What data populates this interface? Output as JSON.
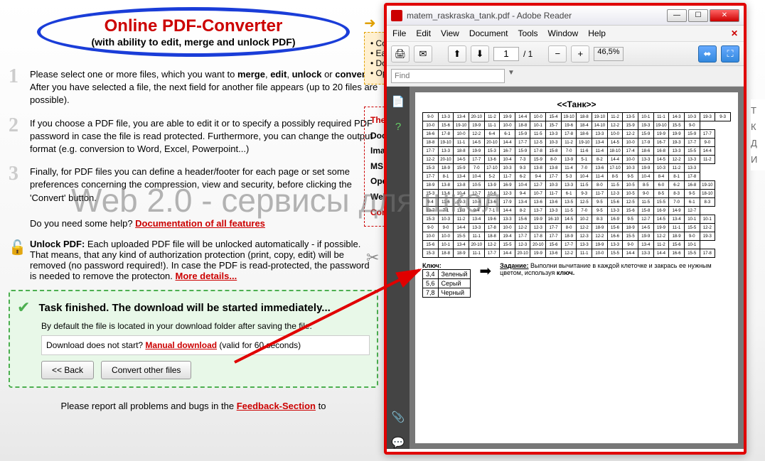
{
  "header": {
    "title": "Online PDF-Converter",
    "subtitle": "(with ability to edit, merge and unlock PDF)"
  },
  "steps": {
    "s1a": "Please select one or more files, which you want to ",
    "s1b": "merge",
    "s1c": ", ",
    "s1d": "edit",
    "s1e": ", ",
    "s1f": "unlock",
    "s1g": " or ",
    "s1h": "convert",
    "s1i": ". After you have selected a file, the next field for another file appears (up to 20 files are possible).",
    "s2": "If you choose a PDF file, you are able to edit it or to specify a possibly required PDF password in case the file is read protected. Furthermore, you can change the output format (e.g. conversion to Word, Excel, Powerpoint...)",
    "s3": "Finally, for PDF files you can define a header/footer for each page or set some preferences concerning the compression, view and security, before clicking the 'Convert' button.",
    "help_prefix": "Do you need some help? ",
    "help_link": "Documentation of all features"
  },
  "unlock": {
    "title": "Unlock PDF:",
    "text": " Each uploaded PDF file will be unlocked automatically - if possible. That means, that any kind of authorization protection (print, copy, edit) will be removed (no password required!). In case the PDF is read-protected, the password is needed to remove the protecton. ",
    "link": "More details..."
  },
  "task": {
    "title": "Task finished. The download will be started immediately...",
    "subtitle": "By default the file is located in your download folder after saving the file.",
    "dl_prefix": "Download does not start? ",
    "dl_link": "Manual download",
    "dl_suffix": " (valid for 60 seconds)",
    "back": "<< Back",
    "convert": "Convert other files"
  },
  "report": {
    "prefix": "Please report all problems and bugs in the ",
    "link": "Feedback-Section",
    "suffix": " to"
  },
  "orange": {
    "l1": "Co",
    "l2": "Ea",
    "l3": "Do",
    "l4": "Op"
  },
  "sidebar": {
    "the": "The",
    "doc": "Docu",
    "img": "Imag",
    "ms": "MS C",
    "ope": "Ope",
    "web": "Web",
    "con": "Con"
  },
  "reader": {
    "title": "matem_raskraska_tank.pdf - Adobe Reader",
    "menu": {
      "file": "File",
      "edit": "Edit",
      "view": "View",
      "document": "Document",
      "tools": "Tools",
      "window": "Window",
      "help": "Help"
    },
    "page_current": "1",
    "page_total": "/ 1",
    "zoom": "46,5%",
    "find": "Find",
    "doc_title": "<<Танк>>",
    "key_label": "Ключ:",
    "key_rows": [
      [
        "3,4",
        "Зеленый"
      ],
      [
        "5,6",
        "Серый"
      ],
      [
        "7,8",
        "Черный"
      ]
    ],
    "task_label": "Задание:",
    "task_body": " Выполни вычитание в каждой клеточке и закрась ее нужным цветом, используя ",
    "task_key": "ключ."
  },
  "chart_data": {
    "type": "table",
    "title": "<<Танк>>",
    "note": "20×20 grid of subtraction expressions (e.g. 9-0, 13-3); each cell result maps to a color via the key table",
    "rows": [
      [
        "9-0",
        "13-3",
        "13-4",
        "20-10",
        "11-2",
        "19-9",
        "14-4",
        "10-0",
        "15-4",
        "19-10",
        "18-8",
        "19-10",
        "11-2",
        "13-5",
        "10-1",
        "11-1",
        "14-3",
        "10-3",
        "19-3",
        "9-3"
      ],
      [
        "10-0",
        "15-6",
        "19-10",
        "19-9",
        "11-1",
        "10-0",
        "18-8",
        "10-1",
        "15-7",
        "19-6",
        "18-4",
        "14-10",
        "12-2",
        "15-9",
        "19-3",
        "19-10",
        "15-5",
        "9-0"
      ],
      [
        "16-6",
        "17-8",
        "10-0",
        "12-2",
        "6-4",
        "6-1",
        "15-9",
        "11-5",
        "13-3",
        "17-8",
        "18-6",
        "13-3",
        "10-0",
        "12-2",
        "15-9",
        "19-9",
        "19-9",
        "15-9",
        "17-7"
      ],
      [
        "18-8",
        "19-10",
        "11-1",
        "14-5",
        "20-10",
        "14-4",
        "17-7",
        "12-5",
        "10-3",
        "11-2",
        "19-10",
        "13-4",
        "14-5",
        "10-0",
        "17-9",
        "16-7",
        "19-3",
        "17-7",
        "9-0"
      ],
      [
        "17-7",
        "13-3",
        "18-8",
        "19-9",
        "15-3",
        "16-7",
        "15-9",
        "17-8",
        "15-8",
        "7-0",
        "11-6",
        "11-4",
        "18-10",
        "17-4",
        "18-6",
        "16-8",
        "13-3",
        "15-5",
        "14-4"
      ],
      [
        "12-2",
        "20-10",
        "14-5",
        "17-7",
        "13-6",
        "10-4",
        "7-3",
        "15-9",
        "8-0",
        "13-9",
        "5-1",
        "8-2",
        "14-4",
        "10-0",
        "13-3",
        "14-5",
        "12-2",
        "13-3",
        "11-2"
      ],
      [
        "15-3",
        "18-9",
        "15-9",
        "7-0",
        "17-10",
        "10-3",
        "9-3",
        "13-8",
        "13-8",
        "11-4",
        "7-0",
        "13-6",
        "17-10",
        "10-3",
        "19-9",
        "10-3",
        "11-2",
        "13-3"
      ],
      [
        "17-7",
        "8-1",
        "13-4",
        "10-4",
        "5-2",
        "11-7",
        "6-2",
        "9-4",
        "17-7",
        "5-3",
        "10-4",
        "11-4",
        "8-5",
        "9-5",
        "10-4",
        "8-4",
        "8-1",
        "17-8"
      ],
      [
        "18-9",
        "13-8",
        "13-8",
        "10-5",
        "13-9",
        "16-9",
        "10-4",
        "12-7",
        "10-3",
        "13-3",
        "11-5",
        "8-0",
        "11-5",
        "10-5",
        "8-5",
        "6-0",
        "6-2",
        "16-8",
        "19-10"
      ],
      [
        "15-3",
        "13-6",
        "10-4",
        "12-7",
        "10-6",
        "12-3",
        "9-4",
        "10-7",
        "11-7",
        "6-1",
        "9-3",
        "11-7",
        "12-3",
        "10-5",
        "9-0",
        "8-5",
        "8-3",
        "9-5",
        "18-10"
      ],
      [
        "9-4",
        "11-6",
        "19-3",
        "10-4",
        "13-6",
        "17-9",
        "13-4",
        "13-6",
        "13-6",
        "13-5",
        "12-5",
        "9-5",
        "15-6",
        "12-5",
        "11-5",
        "15-5",
        "7-0",
        "6-1",
        "8-3"
      ],
      [
        "13-7",
        "7-1",
        "11-3",
        "9-4",
        "7-1",
        "14-4",
        "8-2",
        "13-7",
        "13-3",
        "11-5",
        "7-0",
        "9-5",
        "13-3",
        "15-6",
        "15-8",
        "16-9",
        "14-9",
        "12-7"
      ],
      [
        "15-3",
        "10-3",
        "11-2",
        "13-4",
        "19-6",
        "13-3",
        "15-6",
        "19-9",
        "16-10",
        "14-5",
        "10-2",
        "8-3",
        "16-9",
        "9-5",
        "12-7",
        "14-5",
        "13-4",
        "10-1",
        "10-1"
      ],
      [
        "9-0",
        "9-0",
        "14-4",
        "13-3",
        "17-8",
        "10-0",
        "12-2",
        "12-3",
        "17-7",
        "8-0",
        "12-2",
        "18-9",
        "15-6",
        "18-9",
        "14-5",
        "19-9",
        "11-1",
        "15-5",
        "12-2"
      ],
      [
        "10-0",
        "10-0",
        "15-5",
        "11-1",
        "18-8",
        "19-4",
        "17-7",
        "17-8",
        "17-7",
        "18-9",
        "12-3",
        "12-2",
        "16-6",
        "15-5",
        "19-9",
        "12-2",
        "18-9",
        "9-0",
        "19-3"
      ],
      [
        "15-6",
        "10-1",
        "13-4",
        "20-10",
        "12-2",
        "15-5",
        "12-3",
        "20-10",
        "15-6",
        "17-7",
        "13-3",
        "19-9",
        "13-3",
        "9-0",
        "13-4",
        "11-2",
        "15-6",
        "10-1"
      ],
      [
        "15-3",
        "18-8",
        "18-9",
        "11-1",
        "17-7",
        "14-4",
        "20-10",
        "19-9",
        "13-6",
        "12-2",
        "11-1",
        "10-0",
        "15-5",
        "14-4",
        "13-3",
        "14-4",
        "16-6",
        "15-5",
        "17-8"
      ]
    ],
    "key": [
      {
        "values": "3,4",
        "color": "Зеленый"
      },
      {
        "values": "5,6",
        "color": "Серый"
      },
      {
        "values": "7,8",
        "color": "Черный"
      }
    ]
  },
  "watermark": "Web 2.0 - сервисы для школ",
  "edge": {
    "a": "Т",
    "b": "К",
    "c": "Д",
    "d": "И"
  }
}
